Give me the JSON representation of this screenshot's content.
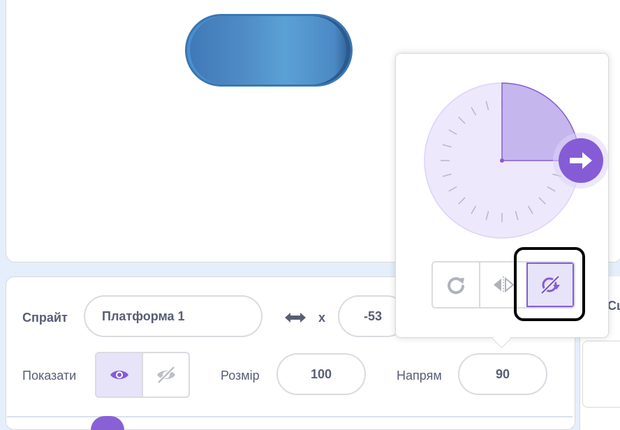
{
  "sprite_info": {
    "sprite_label": "Спрайт",
    "sprite_name": "Платформа 1",
    "x_label": "x",
    "x_value": "-53",
    "show_label": "Показати",
    "size_label": "Розмір",
    "size_value": "100",
    "direction_label": "Напрям",
    "direction_value": "90"
  },
  "right_panel": {
    "label_fragment": "Сц"
  },
  "direction_popover": {
    "direction_degrees": 90,
    "rotation_styles": [
      "all-around",
      "left-right",
      "dont-rotate"
    ],
    "selected_style": "dont-rotate"
  },
  "colors": {
    "accent": "#855cd6",
    "accent_light": "#e7e3f9",
    "dial_fill": "#ede8fb",
    "text": "#575e75",
    "stage_bg": "#ffffff",
    "sprite_blue": "#4c89c4"
  },
  "icons": {
    "xy": "left-right-arrow-icon",
    "show": "eye-icon",
    "hide": "eye-slash-icon",
    "dial_handle": "arrow-right-icon",
    "all_around": "rotate-icon",
    "left_right": "flip-horizontal-icon",
    "dont_rotate": "no-rotate-icon"
  }
}
